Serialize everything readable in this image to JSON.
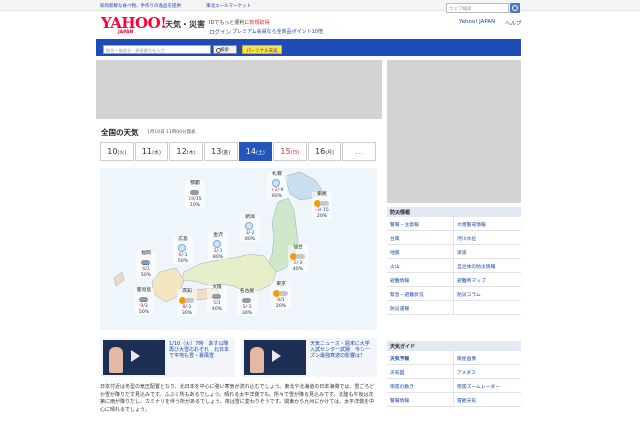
{
  "topbar": {
    "links": [
      "知的新鮮な食べ物、手作りの逸品を提供",
      "東北エールマーケット"
    ]
  },
  "header": {
    "logo": "YAHOO!",
    "logo_sub": "JAPAN",
    "service": "天気・災害",
    "promo1_pre": "IDでもっと便利に",
    "promo1_link": "新規取得",
    "login": "ログイン",
    "promo2": "プレミアム会員なら全商品ポイント10倍",
    "web_search_placeholder": "ウェブ検索",
    "yahoo_japan": "Yahoo! JAPAN",
    "help": "ヘルプ"
  },
  "search": {
    "placeholder": "地名・施設名・郵便番号を入力",
    "button": "検索",
    "personal": "パーソナル天気"
  },
  "main": {
    "title": "全国の天気",
    "date": "1月10日 11時00分発表",
    "tabs": [
      {
        "day": "10",
        "wd": "(火)"
      },
      {
        "day": "11",
        "wd": "(水)"
      },
      {
        "day": "12",
        "wd": "(木)"
      },
      {
        "day": "13",
        "wd": "(金)"
      },
      {
        "day": "14",
        "wd": "(土)"
      },
      {
        "day": "15",
        "wd": "(日)"
      },
      {
        "day": "16",
        "wd": "(月)"
      },
      {
        "day": "…",
        "wd": ""
      }
    ],
    "cities": [
      {
        "name": "札幌",
        "hi": "+2",
        "lo": "/-9",
        "pop": "60%",
        "icon": "snow-icon"
      },
      {
        "name": "那覇",
        "hi": "19",
        "lo": "/15",
        "pop": "10%",
        "icon": "cloud-icon"
      },
      {
        "name": "釧路",
        "hi": "-3",
        "lo": "/-15",
        "pop": "20%",
        "icon": "sun-cloud-icon"
      },
      {
        "name": "新潟",
        "hi": "3",
        "lo": "/-2",
        "pop": "80%",
        "icon": "snow-icon"
      },
      {
        "name": "金沢",
        "hi": "3",
        "lo": "/-1",
        "pop": "80%",
        "icon": "snow-icon"
      },
      {
        "name": "仙台",
        "hi": "2",
        "lo": "/-3",
        "pop": "40%",
        "icon": "sun-cloud-icon"
      },
      {
        "name": "広島",
        "hi": "6",
        "lo": "/-1",
        "pop": "50%",
        "icon": "snow-icon"
      },
      {
        "name": "福岡",
        "hi": "6",
        "lo": "/1",
        "pop": "50%",
        "icon": "cloud-rain-icon"
      },
      {
        "name": "大阪",
        "hi": "5",
        "lo": "/1",
        "pop": "40%",
        "icon": "cloud-icon"
      },
      {
        "name": "名古屋",
        "hi": "5",
        "lo": "/-1",
        "pop": "30%",
        "icon": "cloud-icon"
      },
      {
        "name": "東京",
        "hi": "8",
        "lo": "/1",
        "pop": "20%",
        "icon": "sun-cloud-icon"
      },
      {
        "name": "鹿児島",
        "hi": "9",
        "lo": "/3",
        "pop": "50%",
        "icon": "cloud-rain-icon"
      },
      {
        "name": "高知",
        "hi": "8",
        "lo": "/-1",
        "pop": "30%",
        "icon": "sun-cloud-icon"
      }
    ],
    "news": [
      {
        "title": "1/10（火）7時　あす以降再び大雪のおそれ　北日本で平地も雪・暴風雪"
      },
      {
        "title": "天気ニュース・週末に大学入試センター試験　今シーズン最強寒波の影響は？"
      }
    ],
    "summary": "日本付近は冬型の気圧配置となり、北日本を中心に強い寒気が流れ込むでしょう。東北や北海道の日本海側では、雪ごろどか雪が降りだす見込みです。ふぶく所もあるでしょう。晴れる太平洋側でも、所々で雪が降る見込みです。北陸も午後は次第に雨が降りだし、カミナリを伴う所があるでしょう。夜は雪に変わりそうです。関東から九州にかけては、太平洋側を中心に晴れるでしょう。"
  },
  "sidebar": {
    "disaster_title": "防災情報",
    "disaster_items": [
      "警報・注意報",
      "大雨警戒情報",
      "台風",
      "河川水位",
      "地震",
      "津波",
      "火山",
      "自治体の防災情報",
      "避難情報",
      "避難所マップ",
      "緊急・避難状況",
      "防災コラム",
      "防災速報",
      ""
    ],
    "guide_title": "天気ガイド",
    "guide_items": [
      "天気予報",
      "衛星画像",
      "天気図",
      "アメダス",
      "雨雲の動き",
      "雨雲ズームレーダー",
      "警報情報",
      "雷観天気"
    ]
  }
}
